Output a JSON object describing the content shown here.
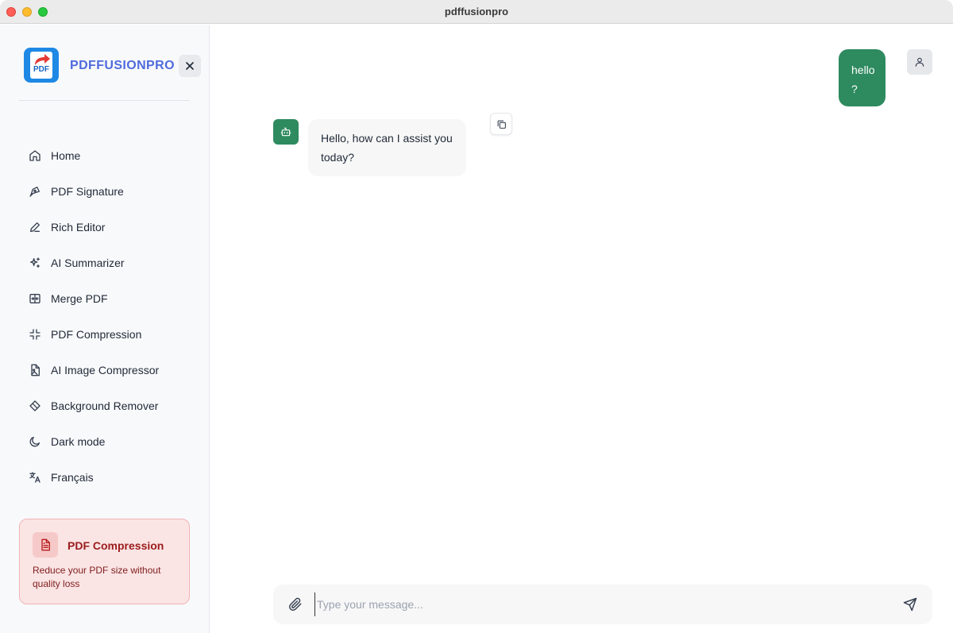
{
  "window": {
    "title": "pdffusionpro"
  },
  "sidebar": {
    "brand": "PDFFUSIONPRO",
    "logo_text": "PDF",
    "items": [
      {
        "label": "Home",
        "icon": "home-icon"
      },
      {
        "label": "PDF Signature",
        "icon": "pen-tool-icon"
      },
      {
        "label": "Rich Editor",
        "icon": "pencil-icon"
      },
      {
        "label": "AI Summarizer",
        "icon": "sparkles-icon"
      },
      {
        "label": "Merge PDF",
        "icon": "merge-icon"
      },
      {
        "label": "PDF Compression",
        "icon": "shrink-icon"
      },
      {
        "label": "AI Image Compressor",
        "icon": "file-image-icon"
      },
      {
        "label": "Background Remover",
        "icon": "eraser-icon"
      },
      {
        "label": "Dark mode",
        "icon": "moon-icon"
      },
      {
        "label": "Français",
        "icon": "languages-icon"
      }
    ],
    "promo": {
      "title": "PDF Compression",
      "description": "Reduce your PDF size without quality loss",
      "icon": "file-text-icon"
    }
  },
  "chat": {
    "messages": [
      {
        "role": "user",
        "text": "hello ?"
      },
      {
        "role": "assistant",
        "text": "Hello, how can I assist you today?"
      }
    ],
    "input": {
      "value": "",
      "placeholder": "Type your message..."
    }
  },
  "colors": {
    "accent_green": "#2e8a5f",
    "brand_blue": "#4f6bdc",
    "promo_red": "#9b1c1c"
  }
}
